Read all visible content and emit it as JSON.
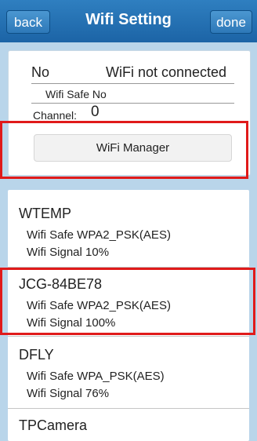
{
  "header": {
    "back_label": "back",
    "title": "Wifi Setting",
    "done_label": "done"
  },
  "connection": {
    "no_label": "No",
    "status": "WiFi not connected",
    "wifi_safe": "Wifi Safe  No",
    "channel_label": "Channel:",
    "channel_value": "0"
  },
  "wifi_manager_label": "WiFi Manager",
  "networks": [
    {
      "name": "WTEMP",
      "safe": "Wifi Safe  WPA2_PSK(AES)",
      "signal": "Wifi Signal  10%"
    },
    {
      "name": "JCG-84BE78",
      "safe": "Wifi Safe  WPA2_PSK(AES)",
      "signal": "Wifi Signal  100%"
    },
    {
      "name": "DFLY",
      "safe": "Wifi Safe  WPA_PSK(AES)",
      "signal": "Wifi Signal  76%"
    },
    {
      "name": "TPCamera"
    }
  ],
  "colors": {
    "header_bg": "#1f68a8",
    "page_bg": "#b9d5ea",
    "highlight": "#e01a1a"
  }
}
